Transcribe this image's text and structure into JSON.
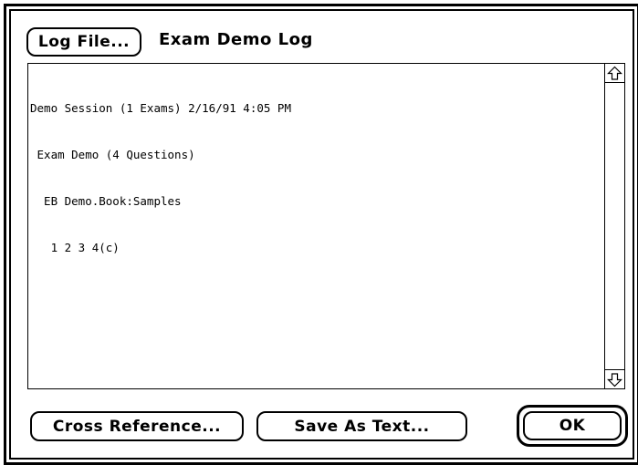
{
  "dialog": {
    "log_file_button": "Log File...",
    "title": "Exam Demo Log"
  },
  "log": {
    "lines": [
      "Demo Session (1 Exams) 2/16/91 4:05 PM",
      " Exam Demo (4 Questions)",
      "  EB Demo.Book:Samples",
      "   1 2 3 4(c)"
    ]
  },
  "scrollbar": {
    "up_icon": "arrow-up-icon",
    "down_icon": "arrow-down-icon"
  },
  "buttons": {
    "cross_reference": "Cross Reference...",
    "save_as_text": "Save As Text...",
    "ok": "OK"
  }
}
